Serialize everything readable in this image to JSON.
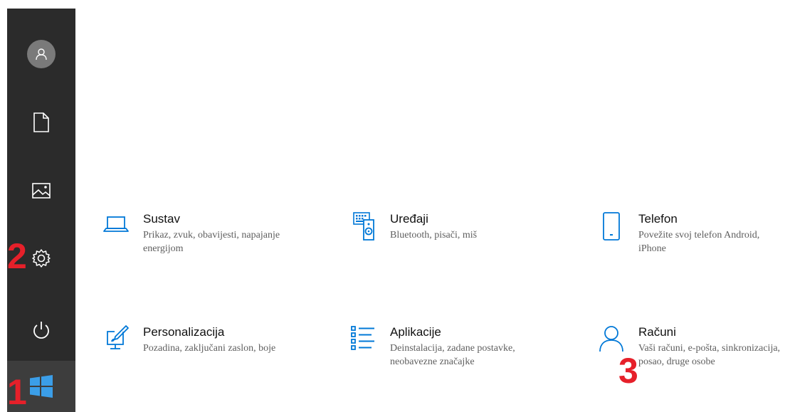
{
  "rail": {
    "items": [
      {
        "name": "user",
        "icon": "user-icon"
      },
      {
        "name": "documents",
        "icon": "document-icon"
      },
      {
        "name": "pictures",
        "icon": "picture-icon"
      },
      {
        "name": "settings",
        "icon": "gear-icon"
      },
      {
        "name": "power",
        "icon": "power-icon"
      }
    ],
    "start_icon": "windows-logo-icon"
  },
  "markers": {
    "one": "1",
    "two": "2",
    "three": "3"
  },
  "tiles": [
    {
      "icon": "laptop-icon",
      "title": "Sustav",
      "description": "Prikaz, zvuk, obavijesti, napajanje energijom"
    },
    {
      "icon": "devices-icon",
      "title": "Uređaji",
      "description": "Bluetooth, pisači, miš"
    },
    {
      "icon": "phone-icon",
      "title": "Telefon",
      "description": "Povežite svoj telefon Android, iPhone"
    },
    {
      "icon": "personalization-icon",
      "title": "Personalizacija",
      "description": "Pozadina, zaključani zaslon, boje"
    },
    {
      "icon": "apps-icon",
      "title": "Aplikacije",
      "description": "Deinstalacija, zadane postavke, neobavezne značajke"
    },
    {
      "icon": "accounts-icon",
      "title": "Računi",
      "description": "Vaši računi, e-pošta, sinkronizacija, posao, druge osobe"
    }
  ],
  "colors": {
    "accent": "#0078d7",
    "rail_bg": "#2b2b2b",
    "marker": "#e6202a",
    "windows_logo": "#3b9ee8"
  }
}
